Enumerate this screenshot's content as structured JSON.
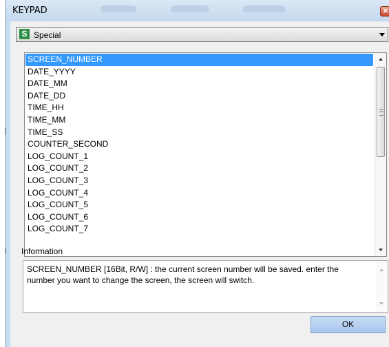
{
  "window": {
    "title": "KEYPAD",
    "close_symbol": "✕",
    "close_icon": "close-icon"
  },
  "category": {
    "badge": "S",
    "badge_color": "#2f8f46",
    "label": "Special",
    "arrow_icon": "chevron-down-icon"
  },
  "list": {
    "selected_index": 0,
    "selection_color": "#3399ff",
    "items": [
      {
        "label": "SCREEN_NUMBER"
      },
      {
        "label": "DATE_YYYY"
      },
      {
        "label": "DATE_MM"
      },
      {
        "label": "DATE_DD"
      },
      {
        "label": "TIME_HH"
      },
      {
        "label": "TIME_MM"
      },
      {
        "label": "TIME_SS"
      },
      {
        "label": "COUNTER_SECOND"
      },
      {
        "label": "LOG_COUNT_1"
      },
      {
        "label": "LOG_COUNT_2"
      },
      {
        "label": "LOG_COUNT_3"
      },
      {
        "label": "LOG_COUNT_4"
      },
      {
        "label": "LOG_COUNT_5"
      },
      {
        "label": "LOG_COUNT_6"
      },
      {
        "label": "LOG_COUNT_7"
      }
    ]
  },
  "information": {
    "heading": "Information",
    "text": "SCREEN_NUMBER [16Bit, R/W] : the current screen number will be saved. enter the number you want to change the screen, the screen will switch."
  },
  "buttons": {
    "ok": "OK"
  }
}
